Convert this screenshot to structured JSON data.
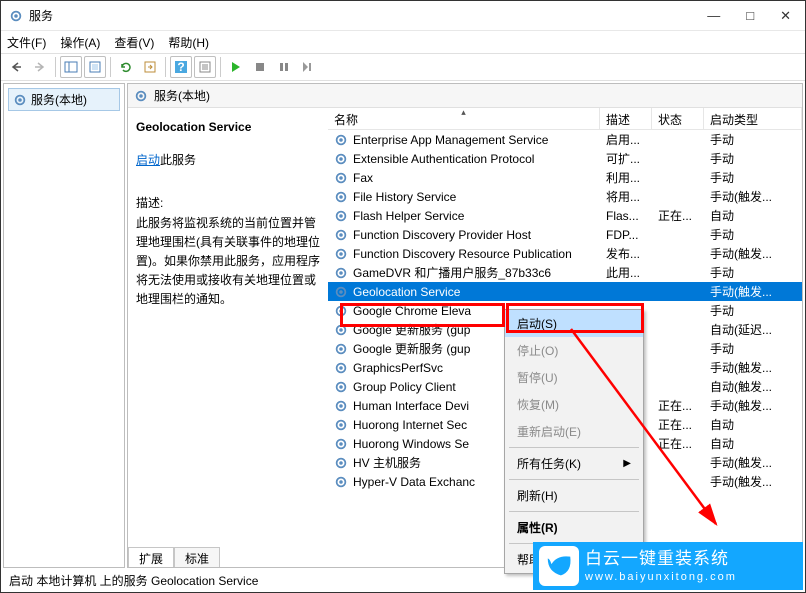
{
  "window": {
    "title": "服务"
  },
  "menus": {
    "file": "文件(F)",
    "action": "操作(A)",
    "view": "查看(V)",
    "help": "帮助(H)"
  },
  "leftPane": {
    "node": "服务(本地)"
  },
  "rightHeader": {
    "title": "服务(本地)"
  },
  "detail": {
    "name": "Geolocation Service",
    "startLink": "启动",
    "startSuffix": "此服务",
    "descLabel": "描述:",
    "desc": "此服务将监视系统的当前位置并管理地理围栏(具有关联事件的地理位置)。如果你禁用此服务，应用程序将无法使用或接收有关地理位置或地理围栏的通知。"
  },
  "columns": {
    "name": "名称",
    "desc": "描述",
    "status": "状态",
    "type": "启动类型"
  },
  "services": [
    {
      "name": "Enterprise App Management Service",
      "desc": "启用...",
      "status": "",
      "type": "手动"
    },
    {
      "name": "Extensible Authentication Protocol",
      "desc": "可扩...",
      "status": "",
      "type": "手动"
    },
    {
      "name": "Fax",
      "desc": "利用...",
      "status": "",
      "type": "手动"
    },
    {
      "name": "File History Service",
      "desc": "将用...",
      "status": "",
      "type": "手动(触发..."
    },
    {
      "name": "Flash Helper Service",
      "desc": "Flas...",
      "status": "正在...",
      "type": "自动"
    },
    {
      "name": "Function Discovery Provider Host",
      "desc": "FDP...",
      "status": "",
      "type": "手动"
    },
    {
      "name": "Function Discovery Resource Publication",
      "desc": "发布...",
      "status": "",
      "type": "手动(触发..."
    },
    {
      "name": "GameDVR 和广播用户服务_87b33c6",
      "desc": "此用...",
      "status": "",
      "type": "手动"
    },
    {
      "name": "Geolocation Service",
      "desc": "",
      "status": "",
      "type": "手动(触发..."
    },
    {
      "name": "Google Chrome Eleva",
      "desc": "",
      "status": "",
      "type": "手动"
    },
    {
      "name": "Google 更新服务 (gup",
      "desc": "",
      "status": "",
      "type": "自动(延迟..."
    },
    {
      "name": "Google 更新服务 (gup",
      "desc": "",
      "status": "",
      "type": "手动"
    },
    {
      "name": "GraphicsPerfSvc",
      "desc": "",
      "status": "",
      "type": "手动(触发..."
    },
    {
      "name": "Group Policy Client",
      "desc": "",
      "status": "",
      "type": "自动(触发..."
    },
    {
      "name": "Human Interface Devi",
      "desc": "",
      "status": "正在...",
      "type": "手动(触发..."
    },
    {
      "name": "Huorong Internet Sec",
      "desc": "",
      "status": "正在...",
      "type": "自动"
    },
    {
      "name": "Huorong Windows Se",
      "desc": "",
      "status": "正在...",
      "type": "自动"
    },
    {
      "name": "HV 主机服务",
      "desc": "",
      "status": "",
      "type": "手动(触发..."
    },
    {
      "name": "Hyper-V Data Exchanc",
      "desc": "",
      "status": "",
      "type": "手动(触发..."
    }
  ],
  "ctxMenu": {
    "start": "启动(S)",
    "stop": "停止(O)",
    "pause": "暂停(U)",
    "resume": "恢复(M)",
    "restart": "重新启动(E)",
    "allTasks": "所有任务(K)",
    "refresh": "刷新(H)",
    "props": "属性(R)",
    "help": "帮助(H)"
  },
  "tabs": {
    "ext": "扩展",
    "std": "标准"
  },
  "status": "启动 本地计算机 上的服务 Geolocation Service",
  "wm": {
    "zh": "白云一键重装系统",
    "url": "www.baiyunxitong.com"
  }
}
